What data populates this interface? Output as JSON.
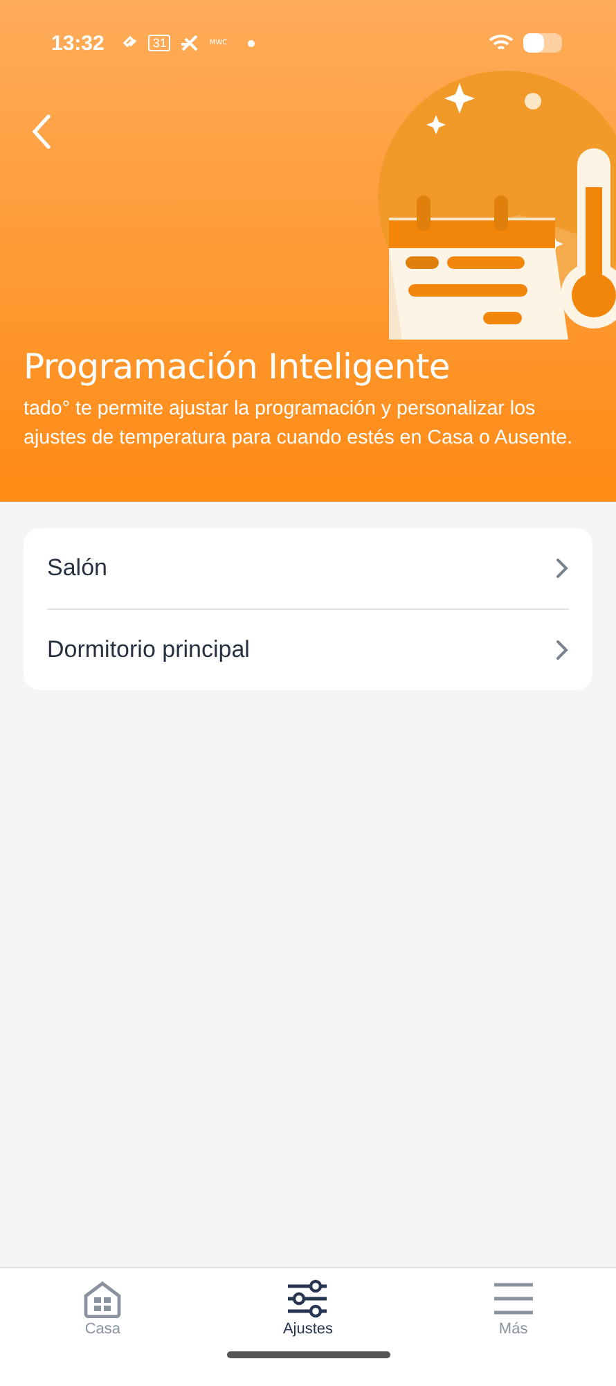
{
  "status_bar": {
    "time": "13:32",
    "calendar_day": "31",
    "carrier_tag": "MWC"
  },
  "header": {
    "title": "Programación Inteligente",
    "description": "tado° te permite ajustar la programación y personalizar los ajustes de temperatura para cuando estés en Casa o Ausente."
  },
  "rooms": [
    {
      "name": "Salón"
    },
    {
      "name": "Dormitorio principal"
    }
  ],
  "tab_bar": [
    {
      "label": "Casa",
      "kind": "home",
      "selected": false
    },
    {
      "label": "Ajustes",
      "kind": "sliders",
      "selected": true
    },
    {
      "label": "Más",
      "kind": "menu",
      "selected": false
    }
  ]
}
